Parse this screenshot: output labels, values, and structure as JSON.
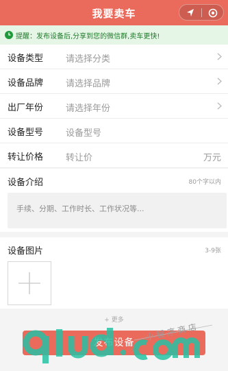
{
  "header": {
    "title": "我要卖车"
  },
  "notice": {
    "text": "提醒：发布设备后,分享到您的微信群,卖车更快!"
  },
  "form": {
    "rows": [
      {
        "label": "设备类型",
        "value": "请选择分类",
        "has_arrow": true
      },
      {
        "label": "设备品牌",
        "value": "请选择品牌",
        "has_arrow": true
      },
      {
        "label": "出厂年份",
        "value": "请选择年份",
        "has_arrow": true
      },
      {
        "label": "设备型号",
        "value": "设备型号",
        "has_arrow": false
      },
      {
        "label": "转让价格",
        "value": "转让价",
        "unit": "万元",
        "has_arrow": false
      }
    ]
  },
  "description": {
    "label": "设备介绍",
    "hint": "80个字以内",
    "placeholder": "手续、分期、工作时长、工作状况等..."
  },
  "photos": {
    "label": "设备图片",
    "hint": "3-9张"
  },
  "more_text": "+ 更多",
  "submit": {
    "label": "发布设备"
  },
  "watermark": {
    "logo_text": "91ud.com",
    "script_text": "小程序商店"
  },
  "colors": {
    "accent": "#ea6a5c",
    "notice_bg": "#e6f6e6",
    "notice_text": "#1f7a2b"
  }
}
